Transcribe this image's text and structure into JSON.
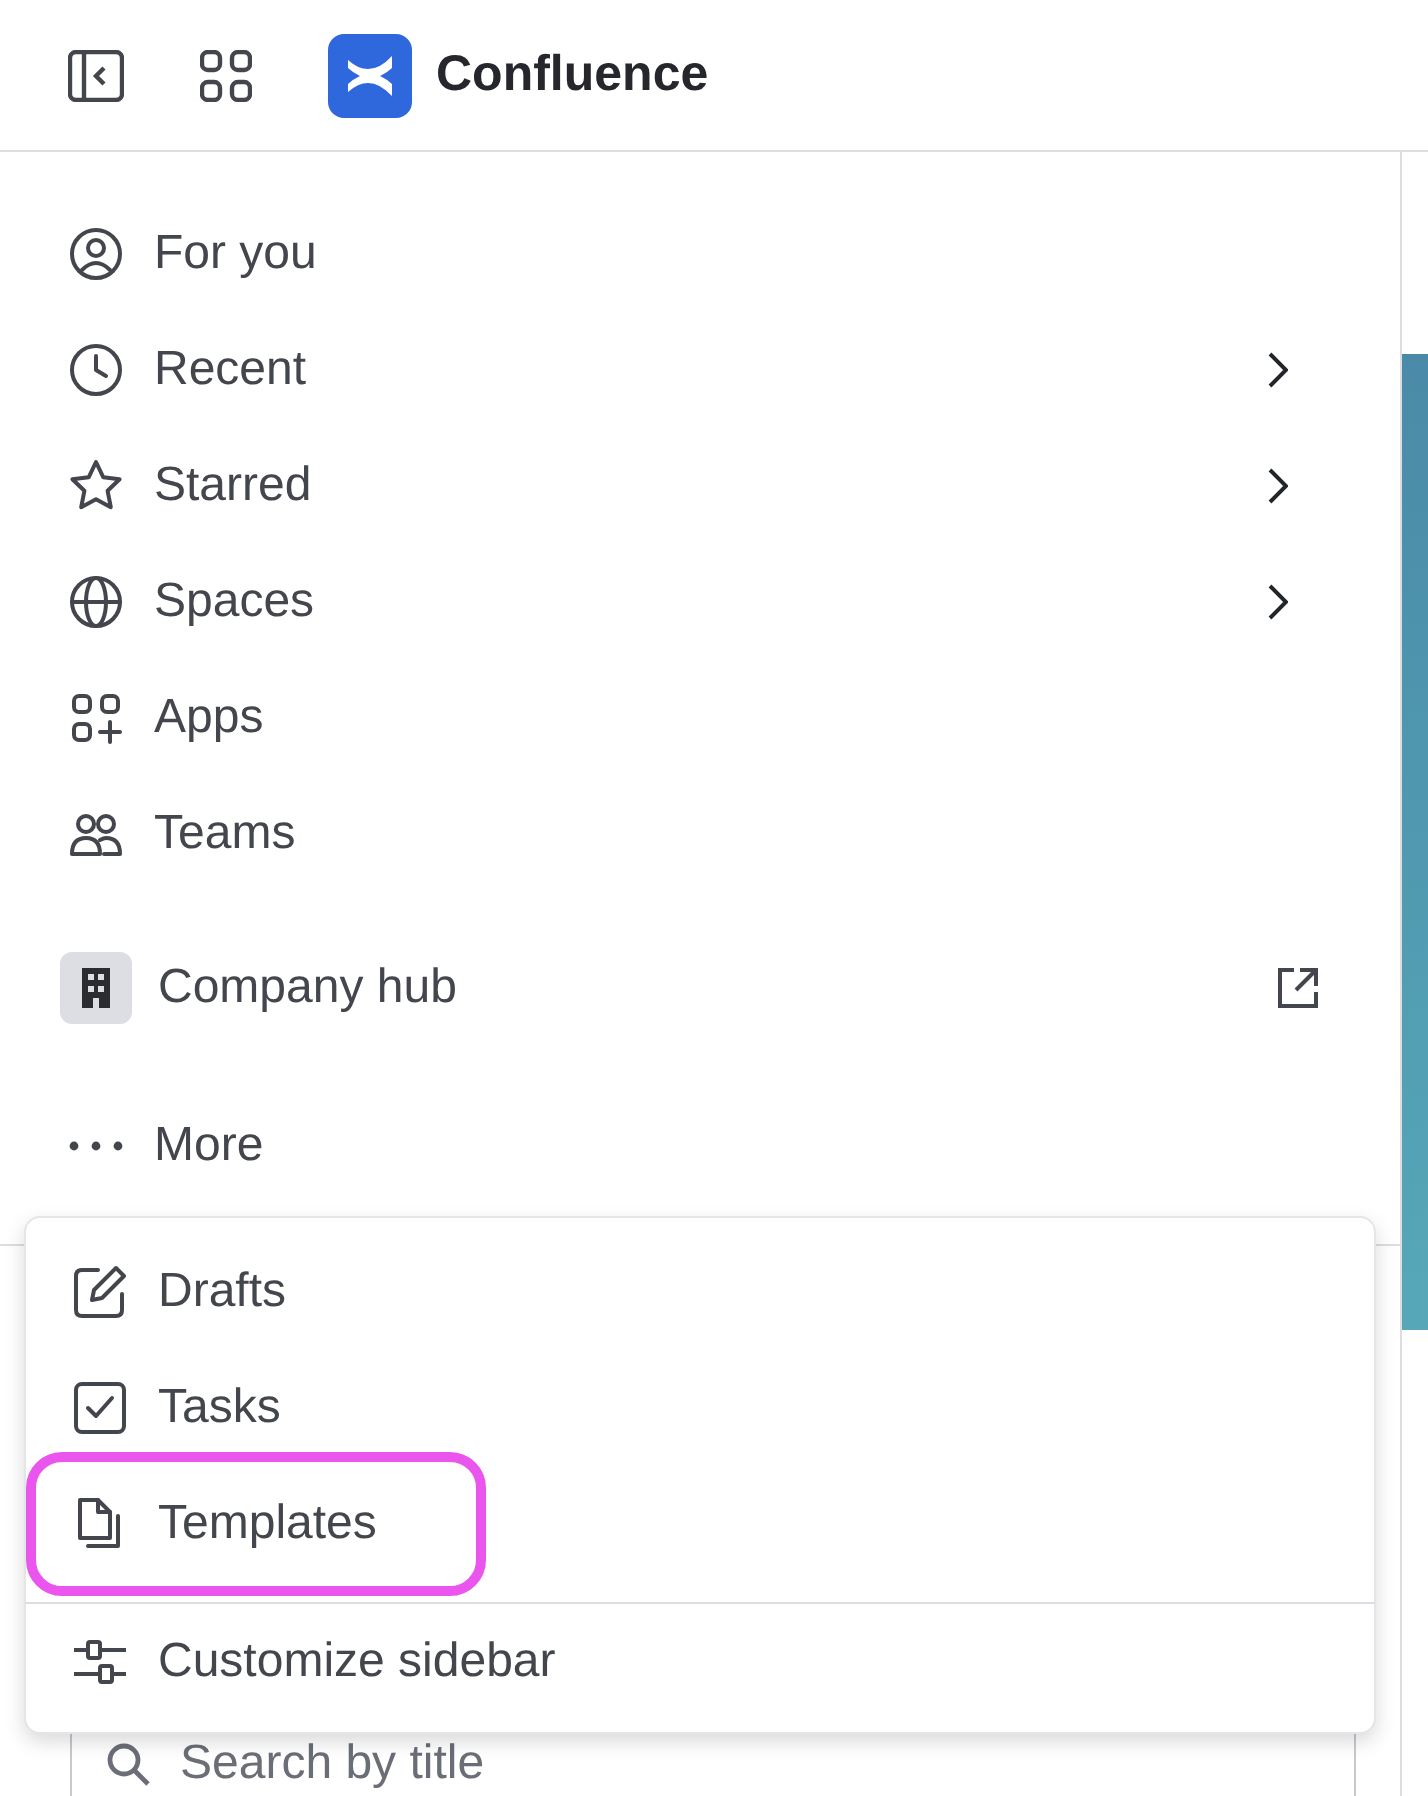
{
  "header": {
    "title": "Confluence"
  },
  "nav": [
    {
      "label": "For you",
      "kind": "person",
      "has_submenu": false
    },
    {
      "label": "Recent",
      "kind": "clock",
      "has_submenu": true
    },
    {
      "label": "Starred",
      "kind": "star",
      "has_submenu": true
    },
    {
      "label": "Spaces",
      "kind": "globe",
      "has_submenu": true
    },
    {
      "label": "Apps",
      "kind": "apps",
      "has_submenu": false
    },
    {
      "label": "Teams",
      "kind": "people",
      "has_submenu": false
    }
  ],
  "hub": {
    "label": "Company hub"
  },
  "more": {
    "label": "More"
  },
  "search": {
    "placeholder": "Search by title"
  },
  "menu": {
    "items": [
      {
        "label": "Drafts",
        "kind": "edit",
        "highlighted": false
      },
      {
        "label": "Tasks",
        "kind": "task",
        "highlighted": false
      },
      {
        "label": "Templates",
        "kind": "template",
        "highlighted": true
      }
    ],
    "footer": {
      "label": "Customize sidebar"
    }
  }
}
